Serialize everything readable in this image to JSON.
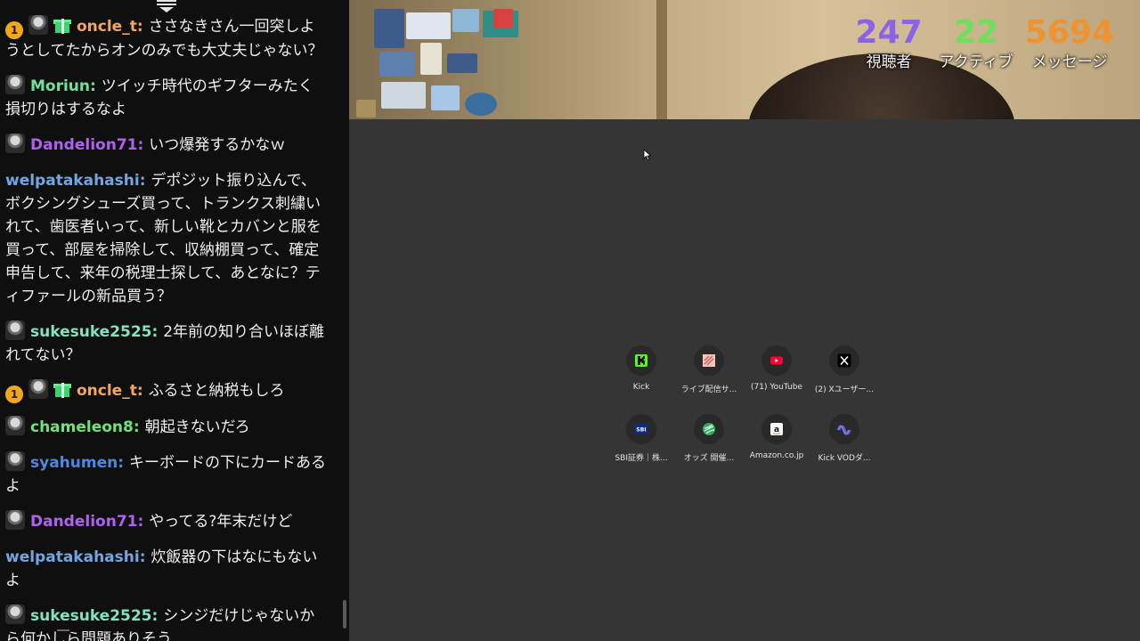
{
  "chat": {
    "messages": [
      {
        "badge": "1",
        "gift": true,
        "user": "oncle_t",
        "color": "#f5a55e",
        "text": "ささなきさん一回突しようとしてたからオンのみでも大丈夫じゃない？"
      },
      {
        "badge": null,
        "gift": false,
        "user": "Moriun",
        "color": "#6fe39a",
        "text": "ツイッチ時代のギフターみたく損切りはするなよ"
      },
      {
        "badge": null,
        "gift": false,
        "user": "Dandelion71",
        "color": "#b061f0",
        "text": "いつ爆発するかなｗ"
      },
      {
        "badge": null,
        "gift": false,
        "user": "welpatakahashi",
        "color": "#72a6e3",
        "text": "デポジット振り込んで、ボクシングシューズ買って、トランクス刺繍いれて、歯医者いって、新しい靴とカバンと服を買って、部屋を掃除して、収納棚買って、確定申告して、来年の税理士探して、あとなに？ティファールの新品買う？",
        "noAvatar": true
      },
      {
        "badge": null,
        "gift": false,
        "user": "sukesuke2525",
        "color": "#7fe3c5",
        "text": "2年前の知り合いほぼ離れてない？"
      },
      {
        "badge": "1",
        "gift": true,
        "user": "oncle_t",
        "color": "#f5a55e",
        "text": "ふるさと納税もしろ"
      },
      {
        "badge": null,
        "gift": false,
        "user": "chameleon8",
        "color": "#6fe37a",
        "text": "朝起きないだろ"
      },
      {
        "badge": null,
        "gift": false,
        "user": "syahumen",
        "color": "#4f87e0",
        "text": "キーボードの下にカードあるよ"
      },
      {
        "badge": null,
        "gift": false,
        "user": "Dandelion71",
        "color": "#b061f0",
        "text": "やってる?年末だけど"
      },
      {
        "badge": null,
        "gift": false,
        "user": "welpatakahashi",
        "color": "#72a6e3",
        "text": "炊飯器の下はなにもないよ",
        "noAvatar": true
      },
      {
        "badge": null,
        "gift": false,
        "user": "sukesuke2525",
        "color": "#7fe3c5",
        "text": "シンジだけじゃないから何かしら問題ありそう"
      }
    ]
  },
  "stream_stats": [
    {
      "value": "247",
      "label": "視聴者",
      "color": "#8a63e8"
    },
    {
      "value": "22",
      "label": "アクティブ",
      "color": "#6ee05a"
    },
    {
      "value": "5694",
      "label": "メッセージ",
      "color": "#f0922e"
    }
  ],
  "shortcuts": [
    {
      "label": "Kick",
      "icon": "kick-icon"
    },
    {
      "label": "ライブ配信サ...",
      "icon": "live-stream-site-icon"
    },
    {
      "label": "(71) YouTube",
      "icon": "youtube-icon"
    },
    {
      "label": "(2) Xユーザー...",
      "icon": "x-icon"
    },
    {
      "label": "SBI証券｜株...",
      "icon": "sbi-icon"
    },
    {
      "label": "オッズ 開催...",
      "icon": "odds-icon"
    },
    {
      "label": "Amazon.co.jp",
      "icon": "amazon-icon"
    },
    {
      "label": "Kick VODダ...",
      "icon": "kick-vod-icon"
    }
  ]
}
